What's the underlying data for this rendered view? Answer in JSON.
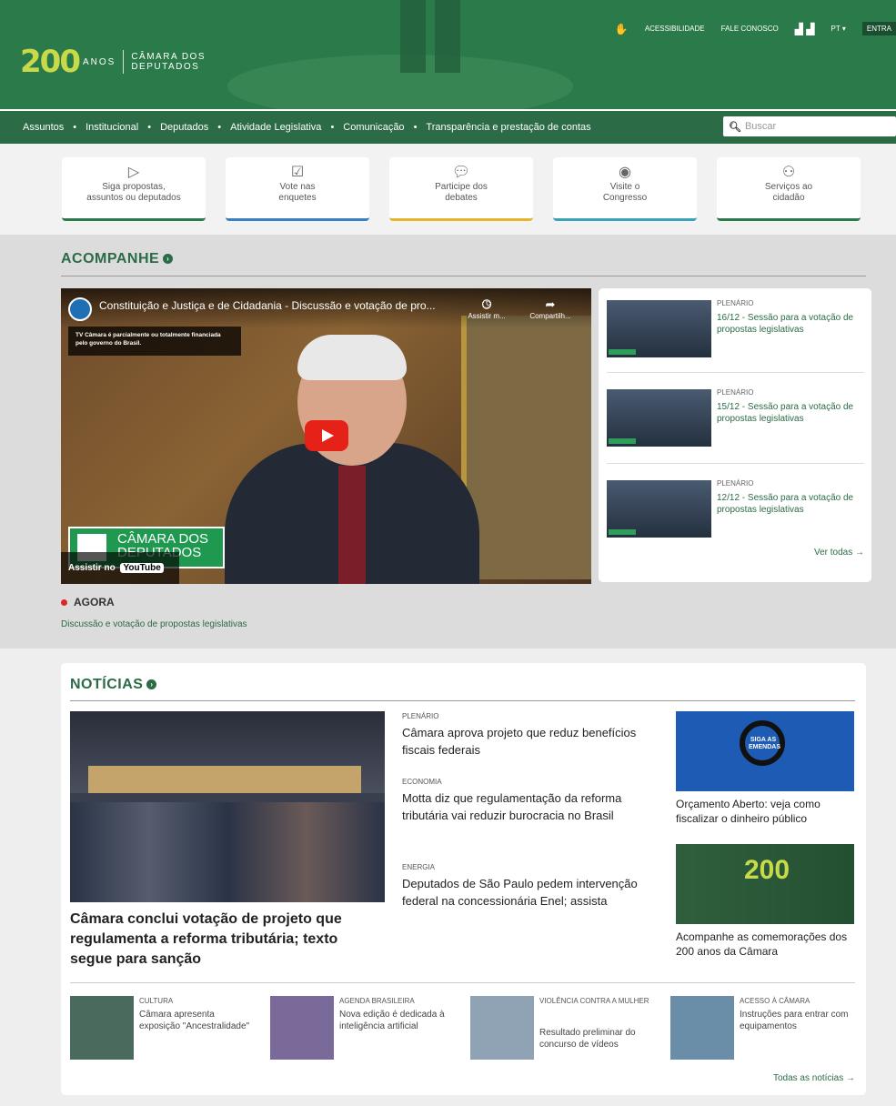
{
  "header": {
    "logo_num": "200",
    "logo_anos": "ANOS",
    "logo_line1": "CÂMARA DOS",
    "logo_line2": "DEPUTADOS",
    "top_links": [
      "ACESSIBILIDADE",
      "FALE CONOSCO",
      "PT ▾",
      "ENTRA"
    ]
  },
  "nav": {
    "items": [
      "Assuntos",
      "Institucional",
      "Deputados",
      "Atividade Legislativa",
      "Comunicação",
      "Transparência e prestação de contas"
    ],
    "search_placeholder": "Buscar"
  },
  "services": [
    {
      "label": "Siga propostas,\nassuntos ou deputados",
      "icon": "send-icon",
      "color": "#2b7a4a"
    },
    {
      "label": "Vote nas\nenquetes",
      "icon": "checkbox-icon",
      "color": "#3a7fc1"
    },
    {
      "label": "Participe dos\ndebates",
      "icon": "chat-icon",
      "color": "#e5b62b"
    },
    {
      "label": "Visite o\nCongresso",
      "icon": "location-icon",
      "color": "#3aa3b5"
    },
    {
      "label": "Serviços ao\ncidadão",
      "icon": "person-icon",
      "color": "#2b7a4a"
    }
  ],
  "acompanhe": {
    "title": "ACOMPANHE",
    "video_title": "Constituição e Justiça e de Cidadania - Discussão e votação de pro...",
    "watch_later": "Assistir m...",
    "share": "Compartilh...",
    "notice": "TV Câmara é parcialmente ou totalmente financiada pelo governo do Brasil.",
    "bug_line1": "CÂMARA DOS",
    "bug_line2": "DEPUTADOS",
    "watch_on": "Assistir no",
    "youtube": "YouTube",
    "live_label": "AGORA",
    "live_desc": "Discussão e votação de propostas legislativas",
    "list": [
      {
        "category": "PLENÁRIO",
        "title": "16/12 - Sessão para a votação de propostas legislativas"
      },
      {
        "category": "PLENÁRIO",
        "title": "15/12 - Sessão para a votação de propostas legislativas"
      },
      {
        "category": "PLENÁRIO",
        "title": "12/12 - Sessão para a votação de propostas legislativas"
      }
    ],
    "see_all": "Ver todas →"
  },
  "news": {
    "title": "NOTÍCIAS",
    "main_headline": "Câmara conclui votação de projeto que regulamenta a reforma tributária; texto segue para sanção",
    "middle": [
      {
        "category": "PLENÁRIO",
        "headline": "Câmara aprova projeto que reduz benefícios fiscais federais"
      },
      {
        "category": "ECONOMIA",
        "headline": "Motta diz que regulamentação da reforma tributária vai reduzir burocracia no Brasil"
      },
      {
        "category": "ENERGIA",
        "headline": "Deputados de São Paulo pedem intervenção federal na concessionária Enel; assista"
      }
    ],
    "right": [
      {
        "headline": "Orçamento Aberto: veja como fiscalizar o dinheiro público",
        "image_text": "SIGA AS EMENDAS"
      },
      {
        "headline": "Acompanhe as comemorações dos 200 anos da Câmara",
        "image_text": "200"
      }
    ],
    "bottom": [
      {
        "category": "CULTURA",
        "headline": "Câmara apresenta exposição \"Ancestralidade\""
      },
      {
        "category": "AGENDA BRASILEIRA",
        "headline": "Nova edição é dedicada à inteligência artificial"
      },
      {
        "category": "VIOLÊNCIA CONTRA A MULHER",
        "headline": "Resultado preliminar do concurso de vídeos"
      },
      {
        "category": "ACESSO À CÂMARA",
        "headline": "Instruções para entrar com equipamentos"
      }
    ],
    "see_all": "Todas as notícias →"
  }
}
